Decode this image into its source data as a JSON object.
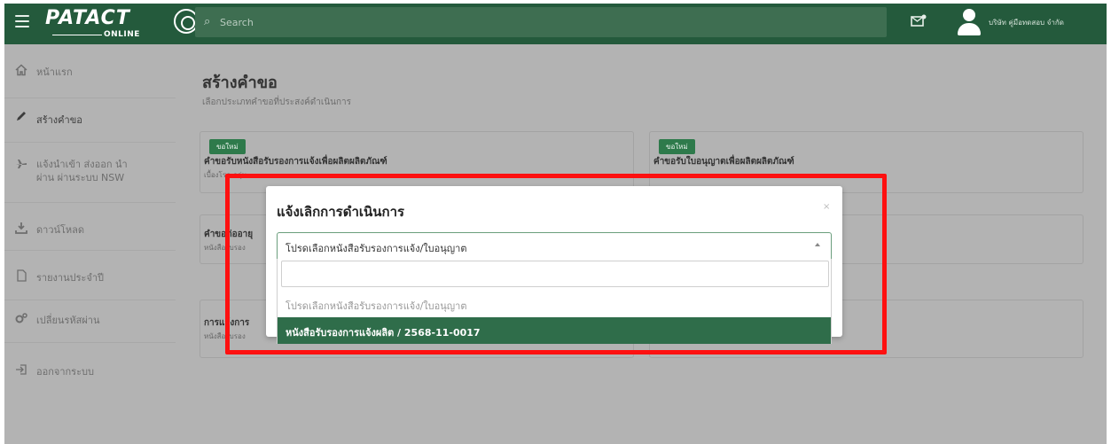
{
  "header": {
    "logo_text": "PATACT",
    "logo_sub": "ONLINE",
    "search_placeholder": "Search",
    "company_name": "บริษัท คู่มือทดสอบ จำกัด"
  },
  "sidebar": {
    "items": [
      {
        "label": "หน้าแรก"
      },
      {
        "label": "สร้างคำขอ"
      },
      {
        "label": "แจ้งนำเข้า ส่งออก นำผ่าน ผ่านระบบ NSW"
      },
      {
        "label": "ดาวน์โหลด"
      },
      {
        "label": "รายงานประจำปี"
      },
      {
        "label": "เปลี่ยนรหัสผ่าน"
      },
      {
        "label": "ออกจากระบบ"
      }
    ]
  },
  "main": {
    "title": "สร้างคำขอ",
    "subtitle": "เลือกประเภทคำขอที่ประสงค์ดำเนินการ",
    "cards": [
      {
        "badge": "ขอใหม่",
        "title": "คำขอรับหนังสือรับรองการแจ้งเพื่อผลิตผลิตภัณฑ์",
        "desc": "เบื้องโรค กลุ่ม"
      },
      {
        "badge": "ขอใหม่",
        "title": "คำขอรับใบอนุญาตเพื่อผลิตผลิตภัณฑ์",
        "desc": ""
      },
      {
        "title": "คำขอต่ออายุ",
        "desc": "หนังสือรับรอง"
      },
      {
        "title": "การแจ้งการ",
        "desc": "หนังสือรับรอง"
      }
    ]
  },
  "modal": {
    "title": "แจ้งเลิกการดำเนินการ",
    "close": "×",
    "select_value": "โปรดเลือกหนังสือรับรองการแจ้ง/ใบอนุญาต",
    "options": [
      "โปรดเลือกหนังสือรับรองการแจ้ง/ใบอนุญาต",
      "หนังสือรับรองการแจ้งผลิต / 2568-11-0017"
    ]
  },
  "colors": {
    "header_bg": "#245a3c",
    "selected_option_bg": "#2f6d4a",
    "badge_bg": "#2e7a4b",
    "highlight": "#ff1010"
  }
}
